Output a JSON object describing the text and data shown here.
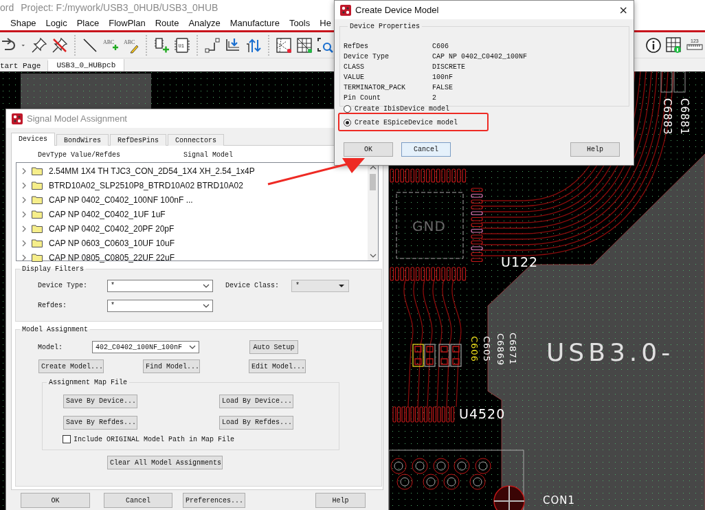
{
  "app": {
    "title_fragment": "ord",
    "project": "Project: F:/mywork/USB3_0HUB/USB3_0HUB",
    "menu": [
      {
        "label": "Shape"
      },
      {
        "label": "Logic"
      },
      {
        "label": "Place"
      },
      {
        "label": "FlowPlan"
      },
      {
        "label": "Route"
      },
      {
        "label": "Analyze"
      },
      {
        "label": "Manufacture"
      },
      {
        "label": "Tools"
      },
      {
        "label": "He"
      }
    ],
    "toolbar_groups": [
      [
        {
          "kind": "redo"
        },
        {
          "kind": "caret"
        },
        {
          "kind": "pin"
        },
        {
          "kind": "unpin"
        }
      ],
      [
        {
          "kind": "line"
        },
        {
          "kind": "text-add",
          "label": "ABC"
        },
        {
          "kind": "text-edit",
          "label": "ABC"
        }
      ],
      [
        {
          "kind": "chip-add"
        },
        {
          "kind": "chip",
          "label": "U1"
        }
      ],
      [
        {
          "kind": "step"
        },
        {
          "kind": "down"
        },
        {
          "kind": "updown"
        }
      ],
      [
        {
          "kind": "ratsnest"
        },
        {
          "kind": "mesh"
        },
        {
          "kind": "zoom"
        }
      ]
    ],
    "toolbar_right": [
      {
        "kind": "info"
      },
      {
        "kind": "grid-info"
      },
      {
        "kind": "ruler",
        "label": "123"
      }
    ],
    "tabs": [
      {
        "label": "tart Page",
        "selected": false
      },
      {
        "label": "USB3_0_HUBpcb",
        "selected": true
      }
    ]
  },
  "board": {
    "labels": [
      {
        "text": "C6883",
        "selected": false
      },
      {
        "text": "C6881",
        "selected": false
      },
      {
        "text": "GND",
        "selected": false
      },
      {
        "text": "U122",
        "selected": false
      },
      {
        "text": "C606",
        "selected": true
      },
      {
        "text": "C605",
        "selected": false
      },
      {
        "text": "C6869",
        "selected": false
      },
      {
        "text": "C6871",
        "selected": false
      },
      {
        "text": "USB3.0-",
        "selected": false
      },
      {
        "text": "U4520",
        "selected": false
      },
      {
        "text": "CON1",
        "selected": false
      }
    ]
  },
  "signal_dialog": {
    "title": "Signal Model Assignment",
    "tabs": [
      {
        "label": "Devices",
        "selected": true
      },
      {
        "label": "BondWires",
        "selected": false
      },
      {
        "label": "RefDesPins",
        "selected": false
      },
      {
        "label": "Connectors",
        "selected": false
      }
    ],
    "columns": [
      "DevType Value/Refdes",
      "Signal Model"
    ],
    "devices": [
      {
        "label": "2.54MM 1X4 TH TJC3_CON_2D54_1X4 XH_2.54_1x4P",
        "expanded": false
      },
      {
        "label": "BTRD10A02_SLP2510P8_BTRD10A02 BTRD10A02",
        "expanded": false
      },
      {
        "label": "CAP NP 0402_C0402_100NF 100nF ...",
        "expanded": false
      },
      {
        "label": "CAP NP 0402_C0402_1UF 1uF",
        "expanded": false
      },
      {
        "label": "CAP NP 0402_C0402_20PF 20pF",
        "expanded": false
      },
      {
        "label": "CAP NP 0603_C0603_10UF 10uF",
        "expanded": false
      },
      {
        "label": "CAP NP 0805_C0805_22UF 22uF",
        "expanded": false
      }
    ],
    "display_filters": {
      "title": "Display Filters",
      "device_type_label": "Device Type:",
      "device_type": "*",
      "device_class_label": "Device Class:",
      "device_class": "*",
      "refdes_label": "Refdes:",
      "refdes": "*"
    },
    "model_assignment": {
      "title": "Model Assignment",
      "model_label": "Model:",
      "model": "402_C0402_100NF_100nF",
      "auto_setup": "Auto Setup",
      "create_model": "Create Model...",
      "find_model": "Find Model...",
      "edit_model": "Edit Model...",
      "map_file": {
        "title": "Assignment Map File",
        "save_device": "Save By Device...",
        "load_device": "Load By Device...",
        "save_refdes": "Save By Refdes...",
        "load_refdes": "Load By Refdes...",
        "include_label": "Include ORIGINAL Model Path in Map File",
        "include_checked": false
      },
      "clear_all": "Clear All Model Assignments"
    },
    "buttons": [
      "OK",
      "Cancel",
      "Preferences...",
      "Help"
    ]
  },
  "create_dialog": {
    "title": "Create Device Model",
    "close": "×",
    "group_title": "Device Properties",
    "properties": [
      {
        "name": "RefDes",
        "value": "C606"
      },
      {
        "name": "Device Type",
        "value": "CAP NP 0402_C0402_100NF"
      },
      {
        "name": "CLASS",
        "value": "DISCRETE"
      },
      {
        "name": "VALUE",
        "value": "100nF"
      },
      {
        "name": "TERMINATOR_PACK",
        "value": "FALSE"
      },
      {
        "name": "Pin Count",
        "value": "2"
      }
    ],
    "options": [
      {
        "label": "Create IbisDevice model",
        "selected": false
      },
      {
        "label": "Create ESpiceDevice model",
        "selected": true
      }
    ],
    "buttons": [
      "OK",
      "Cancel",
      "Help"
    ]
  }
}
